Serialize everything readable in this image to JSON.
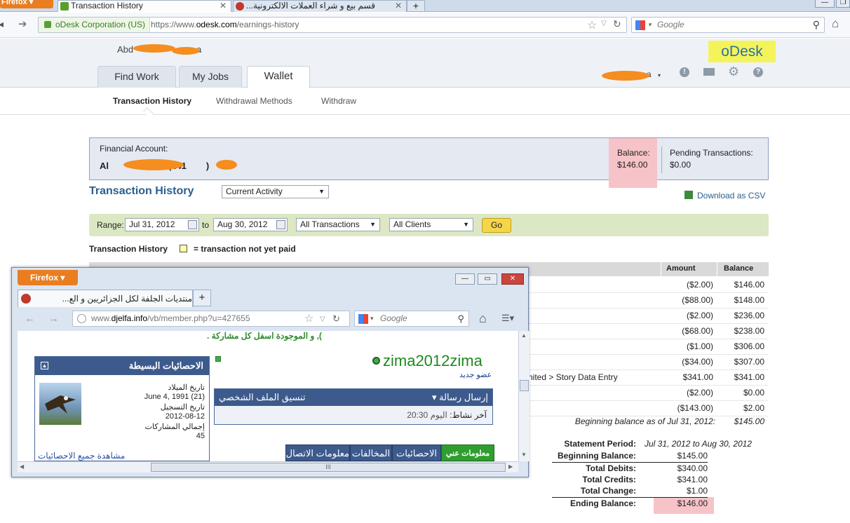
{
  "browser": {
    "firefox_label": "Firefox",
    "tabs": [
      {
        "label": "Transaction History"
      },
      {
        "label": "قسم بيع و شراء العملات الالكترونية..."
      }
    ],
    "new_tab": "+",
    "identity": "oDesk Corporation (US)",
    "url_prefix": "https://www.",
    "url_domain": "odesk.com",
    "url_path": "/earnings-history",
    "search_placeholder": "Google"
  },
  "header": {
    "user_name": "Abd",
    "user_name_tail": "a",
    "logo": "oDesk",
    "nav": {
      "find_work": "Find Work",
      "my_jobs": "My Jobs",
      "wallet": "Wallet"
    },
    "user_menu_tail": "a"
  },
  "subnav": {
    "transaction_history": "Transaction History",
    "withdrawal_methods": "Withdrawal Methods",
    "withdraw": "Withdraw"
  },
  "account": {
    "financial_label": "Financial Account:",
    "name_start": "Al",
    "name_mid": "a (241",
    "name_end": ")",
    "balance_label": "Balance:",
    "balance_value": "$146.00",
    "pending_label": "Pending Transactions:",
    "pending_value": "$0.00"
  },
  "section": {
    "title": "Transaction History",
    "activity_select": "Current Activity",
    "download_csv": "Download as CSV"
  },
  "range": {
    "label": "Range:",
    "from": "Jul 31, 2012",
    "to_label": "to",
    "to": "Aug 30, 2012",
    "type_select": "All Transactions",
    "client_select": "All Clients",
    "go": "Go"
  },
  "legend": {
    "title": "Transaction History",
    "note": "= transaction not yet paid"
  },
  "table": {
    "headers": {
      "amount": "Amount",
      "balance": "Balance"
    },
    "rows": [
      {
        "desc": "",
        "amount": "($2.00)",
        "balance": "$146.00"
      },
      {
        "desc": "",
        "amount": "($88.00)",
        "balance": "$148.00"
      },
      {
        "desc": "",
        "amount": "($2.00)",
        "balance": "$236.00"
      },
      {
        "desc": "",
        "amount": "($68.00)",
        "balance": "$238.00"
      },
      {
        "desc": "",
        "amount": "($1.00)",
        "balance": "$306.00"
      },
      {
        "desc": "",
        "amount": "($34.00)",
        "balance": "$307.00"
      },
      {
        "desc": "nited > Story Data Entry",
        "amount": "$341.00",
        "balance": "$341.00"
      },
      {
        "desc": "",
        "amount": "($2.00)",
        "balance": "$0.00"
      },
      {
        "desc": "",
        "amount": "($143.00)",
        "balance": "$2.00"
      }
    ],
    "beginning_label": "Beginning balance as of Jul 31, 2012:",
    "beginning_value": "$145.00"
  },
  "summary": {
    "period_label": "Statement Period:",
    "period_value": "Jul 31, 2012 to Aug 30, 2012",
    "beginning_label": "Beginning Balance:",
    "beginning_value": "$145.00",
    "debits_label": "Total Debits:",
    "debits_value": "$340.00",
    "credits_label": "Total Credits:",
    "credits_value": "$341.00",
    "change_label": "Total Change:",
    "change_value": "$1.00",
    "ending_label": "Ending Balance:",
    "ending_value": "$146.00"
  },
  "popup": {
    "firefox_label": "Firefox",
    "tab_label": "منتديات الجلفة لكل الجزائريين و الع...",
    "new_tab": "+",
    "url_prefix": "www.",
    "url_domain": "djelfa.info",
    "url_path": "/vb/member.php?u=427655",
    "search_placeholder": "Google",
    "top_note": "), و الموجودة اسفل كل مشاركة .",
    "username": "zima2012zima",
    "user_title": "عضو جديد",
    "stats_title": "الاحصائيات البسيطة",
    "birth_label": "تاريخ الميلاد",
    "birth_value": "June 4, 1991 (21)",
    "reg_label": "تاريخ التسجيل",
    "reg_value": "2012-08-12",
    "posts_label": "إجمالي المشاركات",
    "posts_value": "45",
    "view_all": "مشاهدة جميع الاحصائيات",
    "send_message": "إرسال رسالة",
    "profile_coord": "تنسيق الملف الشخصي",
    "last_activity_label": "آخر نشاط:",
    "last_activity_value": "اليوم 20:30",
    "tabs": {
      "about": "معلومات عني",
      "stats": "الاحصائيات",
      "infractions": "المخالفات",
      "contact": "معلومات الاتصال"
    },
    "hscroll_grip": "III"
  },
  "colors": {
    "brand_blue": "#2b5e8e",
    "firefox_orange": "#e97d1f",
    "highlight_pink": "#f6c3c8",
    "forum_blue": "#3d5a8c"
  }
}
